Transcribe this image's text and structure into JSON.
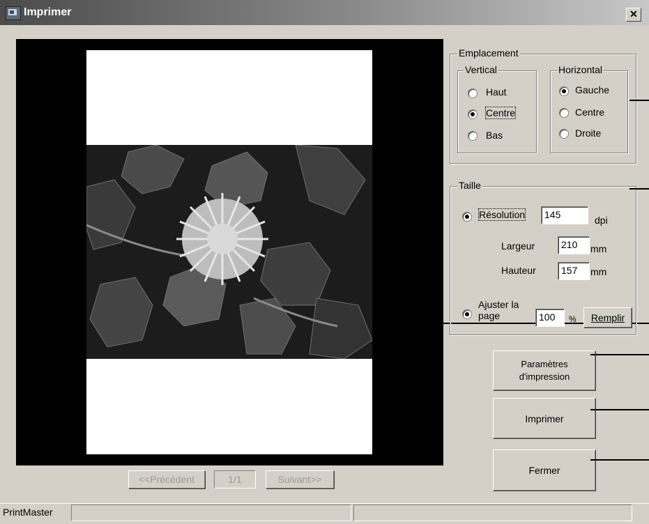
{
  "window": {
    "title": "Imprimer",
    "close_glyph": "✕"
  },
  "navigation": {
    "prev_label": "<<Précédent",
    "page_label": "1/1",
    "next_label": "Suivant>>"
  },
  "emplacement": {
    "title": "Emplacement",
    "vertical": {
      "title": "Vertical",
      "options": [
        "Haut",
        "Centre",
        "Bas"
      ],
      "selected": "Centre"
    },
    "horizontal": {
      "title": "Horizontal",
      "options": [
        "Gauche",
        "Centre",
        "Droite"
      ],
      "selected": "Gauche"
    }
  },
  "taille": {
    "title": "Taille",
    "resolution_label": "Résolution",
    "resolution_value": "145",
    "resolution_unit": "dpi",
    "largeur_label": "Largeur",
    "largeur_value": "210",
    "hauteur_label": "Hauteur",
    "hauteur_value": "157",
    "mm_unit": "mm",
    "fit_label_line1": "Ajuster la",
    "fit_label_line2": "page",
    "percent_value": "100",
    "percent_unit": "%",
    "fill_button": "Remplir"
  },
  "buttons": {
    "print_settings_line1": "Paramètres",
    "print_settings_line2": "d'impression",
    "print": "Imprimer",
    "close": "Fermer"
  },
  "statusbar": {
    "app_name": "PrintMaster"
  }
}
